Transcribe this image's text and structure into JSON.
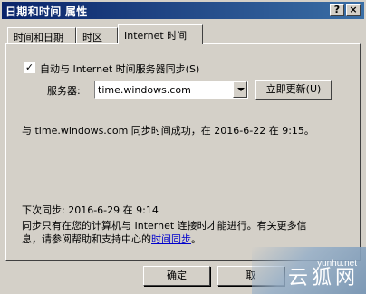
{
  "window": {
    "title": "日期和时间 属性",
    "help_btn": "?",
    "close_btn": "×"
  },
  "tabs": [
    {
      "label": "时间和日期",
      "active": false
    },
    {
      "label": "时区",
      "active": false
    },
    {
      "label": "Internet 时间",
      "active": true
    }
  ],
  "sync": {
    "checkbox_checked": true,
    "checkbox_mark": "✓",
    "checkbox_label": "自动与 Internet 时间服务器同步(S)",
    "server_label": "服务器:",
    "server_value": "time.windows.com",
    "update_button": "立即更新(U)",
    "status_message": "与 time.windows.com 同步时间成功，在 2016-6-22 在 9:15。",
    "next_sync": "下次同步: 2016-6-29 在 9:14",
    "info_line1": "同步只有在您的计算机与 Internet 连接时才能进行。有关更多信",
    "info_line2_prefix": "息，请参阅帮助和支持中心的",
    "info_link": "时间同步",
    "info_line2_suffix": "。"
  },
  "footer": {
    "ok_button": "确定",
    "partial_button": "取"
  },
  "watermark": {
    "url": "yunhu.net",
    "name": "云狐网"
  },
  "colors": {
    "titlebar_start": "#0a246a",
    "titlebar_end": "#3a6ea5",
    "face": "#d4d0c8",
    "link": "#0000cc"
  }
}
